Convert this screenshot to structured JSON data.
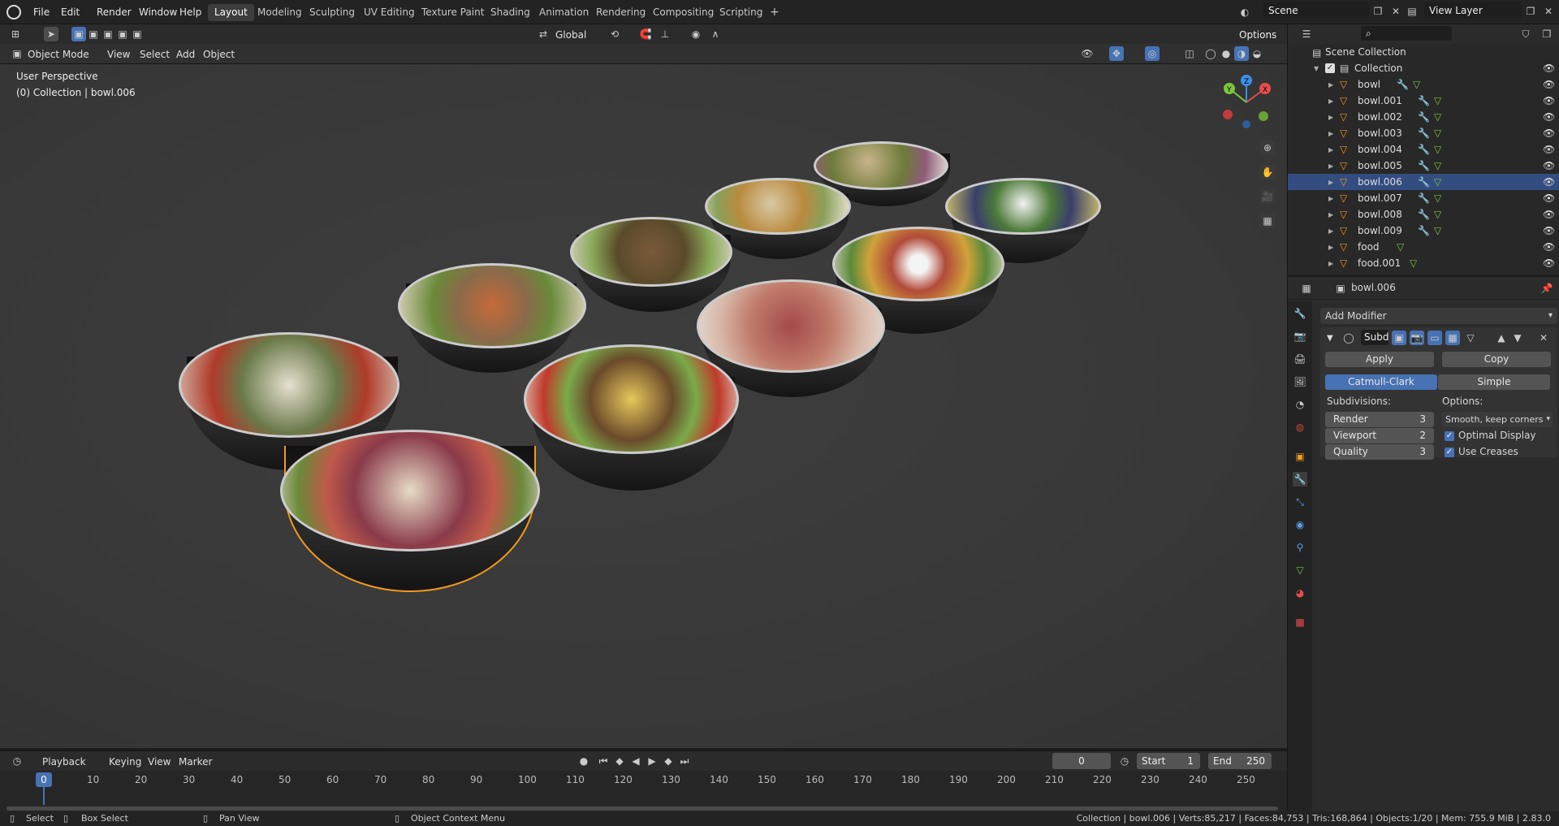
{
  "menubar": {
    "items": [
      "File",
      "Edit",
      "Render",
      "Window",
      "Help"
    ],
    "workspaces": [
      "Layout",
      "Modeling",
      "Sculpting",
      "UV Editing",
      "Texture Paint",
      "Shading",
      "Animation",
      "Rendering",
      "Compositing",
      "Scripting"
    ],
    "active_workspace": "Layout",
    "add_workspace": "+",
    "scene": "Scene",
    "view_layer": "View Layer"
  },
  "viewport_header": {
    "mode": "Object Mode",
    "menus": [
      "View",
      "Select",
      "Add",
      "Object"
    ],
    "orientation": "Global",
    "options": "Options"
  },
  "viewport": {
    "perspective": "User Perspective",
    "collection_info": "(0) Collection | bowl.006",
    "gizmo_axes": [
      "X",
      "Y",
      "Z"
    ]
  },
  "outliner": {
    "root": "Scene Collection",
    "collection": "Collection",
    "items": [
      {
        "name": "bowl",
        "selected": false
      },
      {
        "name": "bowl.001",
        "selected": false
      },
      {
        "name": "bowl.002",
        "selected": false
      },
      {
        "name": "bowl.003",
        "selected": false
      },
      {
        "name": "bowl.004",
        "selected": false
      },
      {
        "name": "bowl.005",
        "selected": false
      },
      {
        "name": "bowl.006",
        "selected": true
      },
      {
        "name": "bowl.007",
        "selected": false
      },
      {
        "name": "bowl.008",
        "selected": false
      },
      {
        "name": "bowl.009",
        "selected": false
      },
      {
        "name": "food",
        "selected": false
      },
      {
        "name": "food.001",
        "selected": false
      }
    ]
  },
  "properties": {
    "object_name": "bowl.006",
    "add_modifier": "Add Modifier",
    "modifier_name": "Subd",
    "apply": "Apply",
    "copy": "Copy",
    "catmull": "Catmull-Clark",
    "simple": "Simple",
    "subdivisions_label": "Subdivisions:",
    "options_label": "Options:",
    "render_label": "Render",
    "render_value": "3",
    "viewport_label": "Viewport",
    "viewport_value": "2",
    "quality_label": "Quality",
    "quality_value": "3",
    "uv_smooth": "Smooth, keep corners",
    "optimal_display": "Optimal Display",
    "use_creases": "Use Creases"
  },
  "timeline": {
    "menus": [
      "Playback",
      "Keying",
      "View",
      "Marker"
    ],
    "current_frame": "0",
    "start_label": "Start",
    "start_value": "1",
    "end_label": "End",
    "end_value": "250",
    "ticks": [
      "0",
      "10",
      "20",
      "30",
      "40",
      "50",
      "60",
      "70",
      "80",
      "90",
      "100",
      "110",
      "120",
      "130",
      "140",
      "150",
      "160",
      "170",
      "180",
      "190",
      "200",
      "210",
      "220",
      "230",
      "240",
      "250"
    ]
  },
  "statusbar": {
    "select": "Select",
    "box_select": "Box Select",
    "pan_view": "Pan View",
    "context_menu": "Object Context Menu",
    "stats": "Collection | bowl.006 | Verts:85,217 | Faces:84,753 | Tris:168,864 | Objects:1/20 | Mem: 755.9 MiB | 2.83.0"
  },
  "colors": {
    "accent": "#4772b3",
    "selected_row": "#334d80",
    "selection_outline": "#f29a1a",
    "x_axis": "#e84c4c",
    "y_axis": "#7bc63b",
    "z_axis": "#3d8fe8"
  }
}
